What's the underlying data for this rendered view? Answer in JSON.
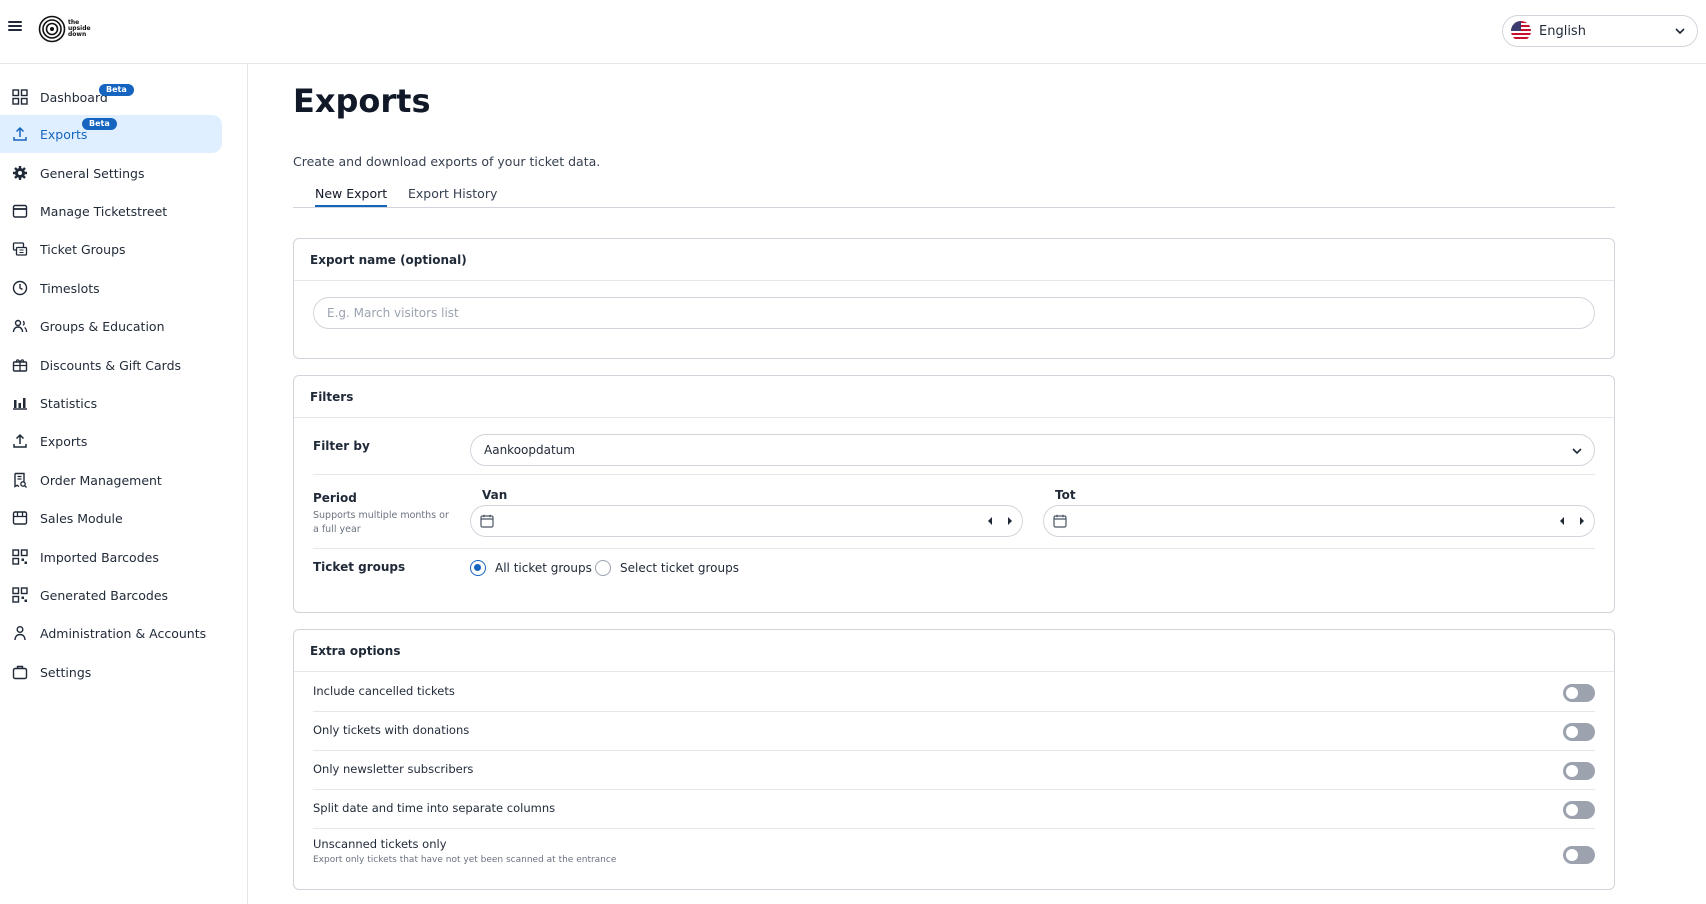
{
  "header": {
    "logo_text": "the upside down",
    "language": "English"
  },
  "sidebar": {
    "items": [
      {
        "label": "Dashboard",
        "badge": "Beta",
        "icon": "grid-icon"
      },
      {
        "label": "Exports",
        "badge": "Beta",
        "icon": "upload-icon",
        "active": true
      },
      {
        "label": "General Settings",
        "icon": "gear-icon"
      },
      {
        "label": "Manage Ticketstreet",
        "icon": "calendar-icon"
      },
      {
        "label": "Ticket Groups",
        "icon": "ticket-icon"
      },
      {
        "label": "Timeslots",
        "icon": "clock-icon"
      },
      {
        "label": "Groups & Education",
        "icon": "users-icon"
      },
      {
        "label": "Discounts & Gift Cards",
        "icon": "gift-icon"
      },
      {
        "label": "Statistics",
        "icon": "bar-chart-icon"
      },
      {
        "label": "Exports",
        "icon": "upload-icon"
      },
      {
        "label": "Order Management",
        "icon": "receipt-icon"
      },
      {
        "label": "Sales Module",
        "icon": "store-icon"
      },
      {
        "label": "Imported Barcodes",
        "icon": "qr-code-icon"
      },
      {
        "label": "Generated Barcodes",
        "icon": "qr-code-icon"
      },
      {
        "label": "Administration & Accounts",
        "icon": "person-icon"
      },
      {
        "label": "Settings",
        "icon": "briefcase-icon"
      }
    ]
  },
  "main": {
    "title": "Exports",
    "description": "Create and download exports of your ticket data.",
    "tabs": [
      {
        "label": "New Export",
        "active": true
      },
      {
        "label": "Export History",
        "active": false
      }
    ],
    "export_name": {
      "heading": "Export name (optional)",
      "placeholder": "E.g. March visitors list",
      "value": ""
    },
    "filters": {
      "heading": "Filters",
      "filter_by_label": "Filter by",
      "filter_by_value": "Aankoopdatum",
      "period_label": "Period",
      "period_sub": "Supports multiple months or a full year",
      "from_label": "Van",
      "to_label": "Tot",
      "ticket_groups_label": "Ticket groups",
      "options": [
        {
          "label": "All ticket groups",
          "checked": true
        },
        {
          "label": "Select ticket groups",
          "checked": false
        }
      ]
    },
    "extra_options": {
      "heading": "Extra options",
      "items": [
        {
          "label": "Include cancelled tickets",
          "enabled": false
        },
        {
          "label": "Only tickets with donations",
          "enabled": false
        },
        {
          "label": "Only newsletter subscribers",
          "enabled": false
        },
        {
          "label": "Split date and time into separate columns",
          "enabled": false
        },
        {
          "label": "Unscanned tickets only",
          "sub": "Export only tickets that have not yet been scanned at the entrance",
          "enabled": false
        }
      ]
    }
  },
  "colors": {
    "accent": "#1565c0",
    "active_bg": "#e0efff",
    "toggle_off": "#9ca3af"
  }
}
